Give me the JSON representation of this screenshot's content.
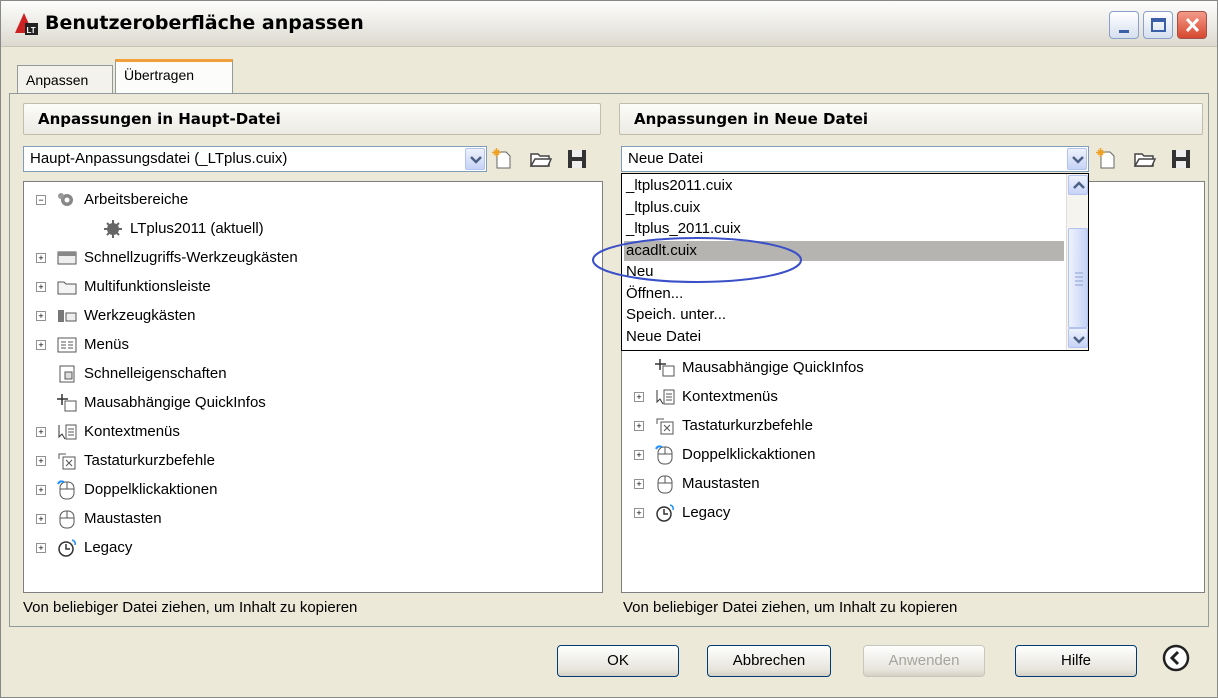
{
  "window": {
    "title": "Benutzeroberfläche anpassen"
  },
  "tabs": [
    {
      "label": "Anpassen",
      "active": false
    },
    {
      "label": "Übertragen",
      "active": true
    }
  ],
  "left_panel": {
    "header": "Anpassungen in Haupt-Datei",
    "combo_value": "Haupt-Anpassungsdatei (_LTplus.cuix)",
    "tree": [
      {
        "label": "Arbeitsbereiche",
        "expander": "minus",
        "icon": "workspaces-icon"
      },
      {
        "label": "LTplus2011 (aktuell)",
        "expander": "",
        "icon": "gear-icon"
      },
      {
        "label": "Schnellzugriffs-Werkzeugkästen",
        "expander": "plus",
        "icon": "quick-access-toolbar-icon"
      },
      {
        "label": "Multifunktionsleiste",
        "expander": "plus",
        "icon": "ribbon-folder-icon"
      },
      {
        "label": "Werkzeugkästen",
        "expander": "plus",
        "icon": "toolbars-icon"
      },
      {
        "label": "Menüs",
        "expander": "plus",
        "icon": "menus-icon"
      },
      {
        "label": "Schnelleigenschaften",
        "expander": "",
        "icon": "quick-properties-icon"
      },
      {
        "label": "Mausabhängige QuickInfos",
        "expander": "",
        "icon": "rollover-tooltips-icon"
      },
      {
        "label": "Kontextmenüs",
        "expander": "plus",
        "icon": "shortcut-menus-icon"
      },
      {
        "label": "Tastaturkurzbefehle",
        "expander": "plus",
        "icon": "keyboard-shortcuts-icon"
      },
      {
        "label": "Doppelklickaktionen",
        "expander": "plus",
        "icon": "double-click-actions-icon"
      },
      {
        "label": "Maustasten",
        "expander": "plus",
        "icon": "mouse-buttons-icon"
      },
      {
        "label": "Legacy",
        "expander": "plus",
        "icon": "legacy-icon"
      }
    ],
    "status": "Von beliebiger Datei ziehen, um Inhalt zu kopieren"
  },
  "right_panel": {
    "header": "Anpassungen in Neue Datei",
    "combo_value": "Neue Datei",
    "dropdown_options": [
      {
        "label": "_ltplus2011.cuix",
        "selected": false
      },
      {
        "label": "_ltplus.cuix",
        "selected": false
      },
      {
        "label": "_ltplus_2011.cuix",
        "selected": false
      },
      {
        "label": "acadlt.cuix",
        "selected": true
      },
      {
        "label": "Neu",
        "selected": false
      },
      {
        "label": "Öffnen...",
        "selected": false
      },
      {
        "label": "Speich. unter...",
        "selected": false
      },
      {
        "label": "Neue Datei",
        "selected": false
      }
    ],
    "tree": [
      {
        "label": "Mausabhängige QuickInfos",
        "expander": "",
        "icon": "rollover-tooltips-icon"
      },
      {
        "label": "Kontextmenüs",
        "expander": "plus",
        "icon": "shortcut-menus-icon"
      },
      {
        "label": "Tastaturkurzbefehle",
        "expander": "plus",
        "icon": "keyboard-shortcuts-icon"
      },
      {
        "label": "Doppelklickaktionen",
        "expander": "plus",
        "icon": "double-click-actions-icon"
      },
      {
        "label": "Maustasten",
        "expander": "plus",
        "icon": "mouse-buttons-icon"
      },
      {
        "label": "Legacy",
        "expander": "plus",
        "icon": "legacy-icon"
      }
    ],
    "status": "Von beliebiger Datei ziehen, um Inhalt zu kopieren"
  },
  "buttons": {
    "ok": "OK",
    "abbrechen": "Abbrechen",
    "anwenden": "Anwenden",
    "hilfe": "Hilfe"
  },
  "colors": {
    "dialog_bg": "#ece9d8",
    "selected_tab_accent": "#f2a03a",
    "selection_bg": "#b5b4b0",
    "annotation_ellipse": "#3a4fc8"
  }
}
